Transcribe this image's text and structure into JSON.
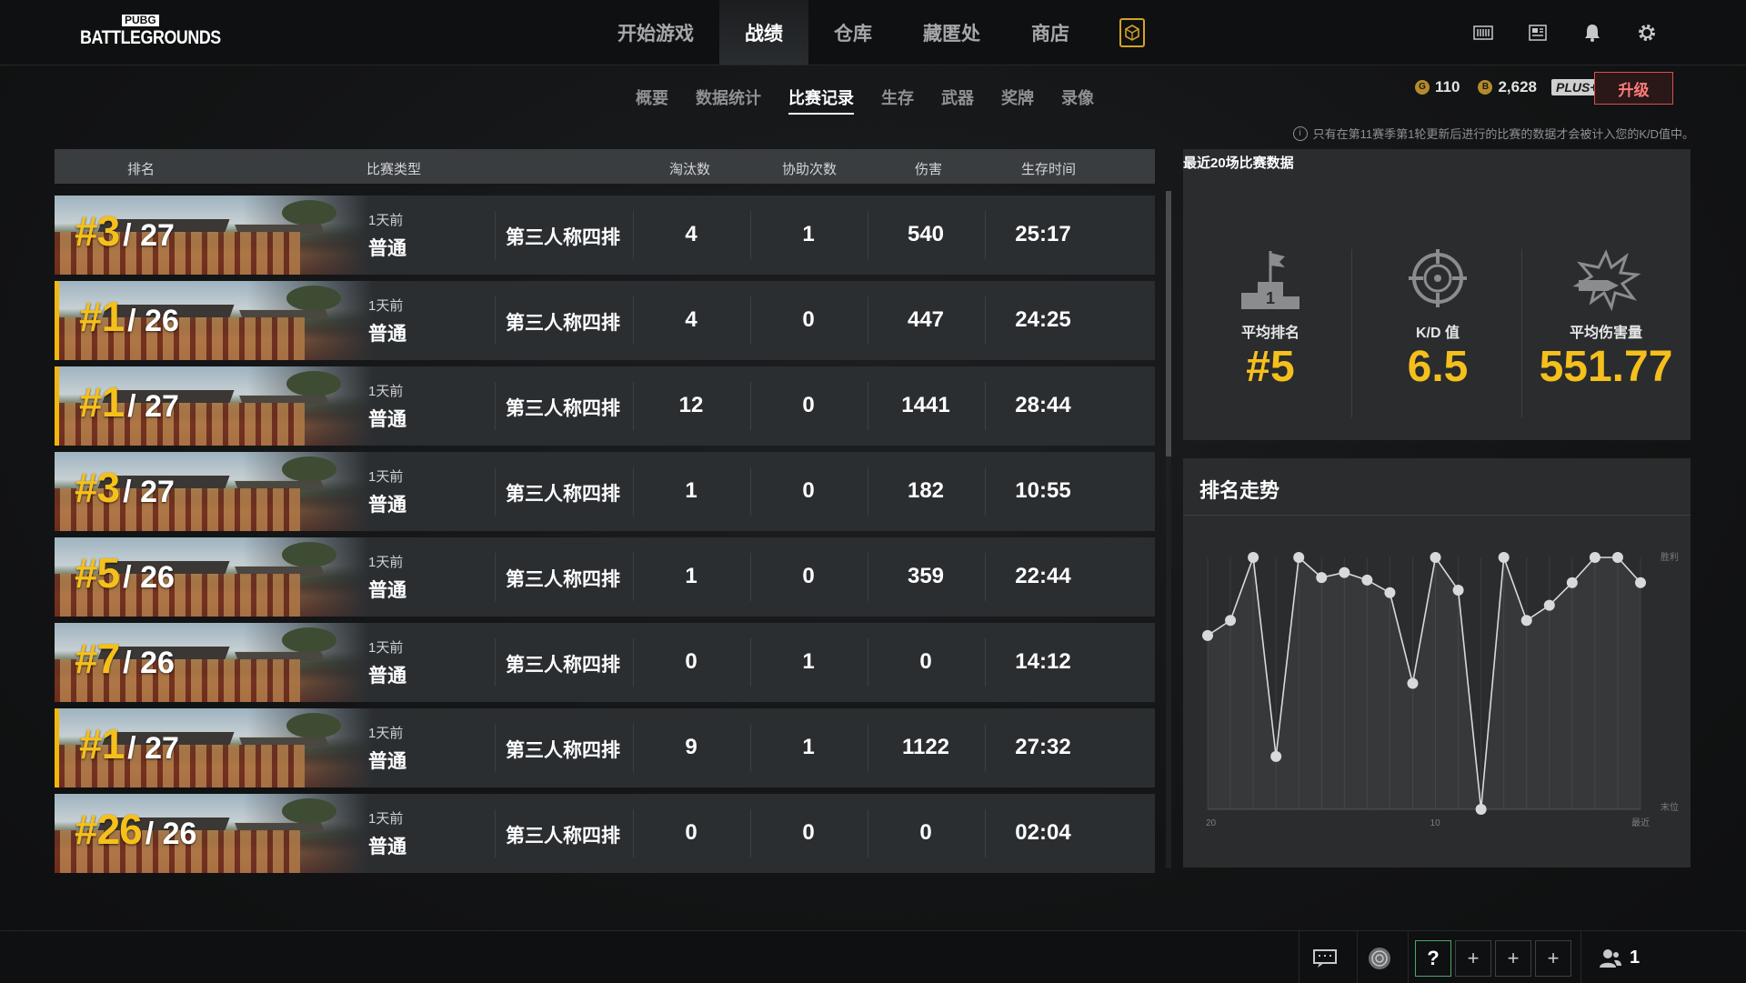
{
  "logo": {
    "top": "PUBG",
    "main": "BATTLEGROUNDS"
  },
  "nav": {
    "tabs": [
      {
        "label": "开始游戏"
      },
      {
        "label": "战绩"
      },
      {
        "label": "仓库"
      },
      {
        "label": "藏匿处"
      },
      {
        "label": "商店"
      }
    ],
    "active": "战绩"
  },
  "subnav": {
    "tabs": [
      {
        "label": "概要"
      },
      {
        "label": "数据统计"
      },
      {
        "label": "比赛记录"
      },
      {
        "label": "生存"
      },
      {
        "label": "武器"
      },
      {
        "label": "奖牌"
      },
      {
        "label": "录像"
      }
    ],
    "active": "比赛记录"
  },
  "currency": {
    "g_coin": "110",
    "bp": "2,628",
    "plus_label": "PLUS+",
    "upgrade_label": "升级"
  },
  "notice": "只有在第11赛季第1轮更新后进行的比赛的数据才会被计入您的K/D值中。",
  "table": {
    "headers": {
      "rank": "排名",
      "type": "比赛类型",
      "kills": "淘汰数",
      "assists": "协助次数",
      "damage": "伤害",
      "survival": "生存时间"
    },
    "rows": [
      {
        "rank": "#3",
        "total": "/ 27",
        "when": "1天前",
        "mode": "普通",
        "mtype": "第三人称四排",
        "kills": "4",
        "assists": "1",
        "damage": "540",
        "survival": "25:17",
        "win": false
      },
      {
        "rank": "#1",
        "total": "/ 26",
        "when": "1天前",
        "mode": "普通",
        "mtype": "第三人称四排",
        "kills": "4",
        "assists": "0",
        "damage": "447",
        "survival": "24:25",
        "win": true
      },
      {
        "rank": "#1",
        "total": "/ 27",
        "when": "1天前",
        "mode": "普通",
        "mtype": "第三人称四排",
        "kills": "12",
        "assists": "0",
        "damage": "1441",
        "survival": "28:44",
        "win": true
      },
      {
        "rank": "#3",
        "total": "/ 27",
        "when": "1天前",
        "mode": "普通",
        "mtype": "第三人称四排",
        "kills": "1",
        "assists": "0",
        "damage": "182",
        "survival": "10:55",
        "win": false
      },
      {
        "rank": "#5",
        "total": "/ 26",
        "when": "1天前",
        "mode": "普通",
        "mtype": "第三人称四排",
        "kills": "1",
        "assists": "0",
        "damage": "359",
        "survival": "22:44",
        "win": false
      },
      {
        "rank": "#7",
        "total": "/ 26",
        "when": "1天前",
        "mode": "普通",
        "mtype": "第三人称四排",
        "kills": "0",
        "assists": "1",
        "damage": "0",
        "survival": "14:12",
        "win": false
      },
      {
        "rank": "#1",
        "total": "/ 27",
        "when": "1天前",
        "mode": "普通",
        "mtype": "第三人称四排",
        "kills": "9",
        "assists": "1",
        "damage": "1122",
        "survival": "27:32",
        "win": true
      },
      {
        "rank": "#26",
        "total": "/ 26",
        "when": "1天前",
        "mode": "普通",
        "mtype": "第三人称四排",
        "kills": "0",
        "assists": "0",
        "damage": "0",
        "survival": "02:04",
        "win": false
      }
    ]
  },
  "summary": {
    "title": "最近20场比赛数据",
    "avg_rank_label": "平均排名",
    "avg_rank": "#5",
    "kd_label": "K/D 值",
    "kd": "6.5",
    "avg_damage_label": "平均伤害量",
    "avg_damage": "551.77"
  },
  "trend": {
    "title": "排名走势",
    "chart_data": {
      "type": "line",
      "title": "排名走势",
      "x_labels": [
        "20",
        "10",
        "最近"
      ],
      "y_labels": [
        "胜利",
        "末位"
      ],
      "x": [
        20,
        19,
        18,
        17,
        16,
        15,
        14,
        13,
        12,
        11,
        10,
        9,
        8,
        7,
        6,
        5,
        4,
        3,
        2,
        1
      ],
      "values": [
        0.69,
        0.75,
        1.0,
        0.21,
        1.0,
        0.92,
        0.94,
        0.91,
        0.86,
        0.5,
        1.0,
        0.87,
        0.0,
        1.0,
        0.75,
        0.81,
        0.9,
        1.0,
        1.0,
        0.9
      ],
      "value_meaning": "normalized rank, 1 = 胜利, 0 = 末位",
      "color": "#d9d9d9"
    }
  },
  "bottom": {
    "party_count": "1",
    "help_label": "?"
  },
  "colors": {
    "accent": "#f5c01c",
    "upgrade": "#ff7b7b",
    "help_border": "#4ea66a"
  }
}
